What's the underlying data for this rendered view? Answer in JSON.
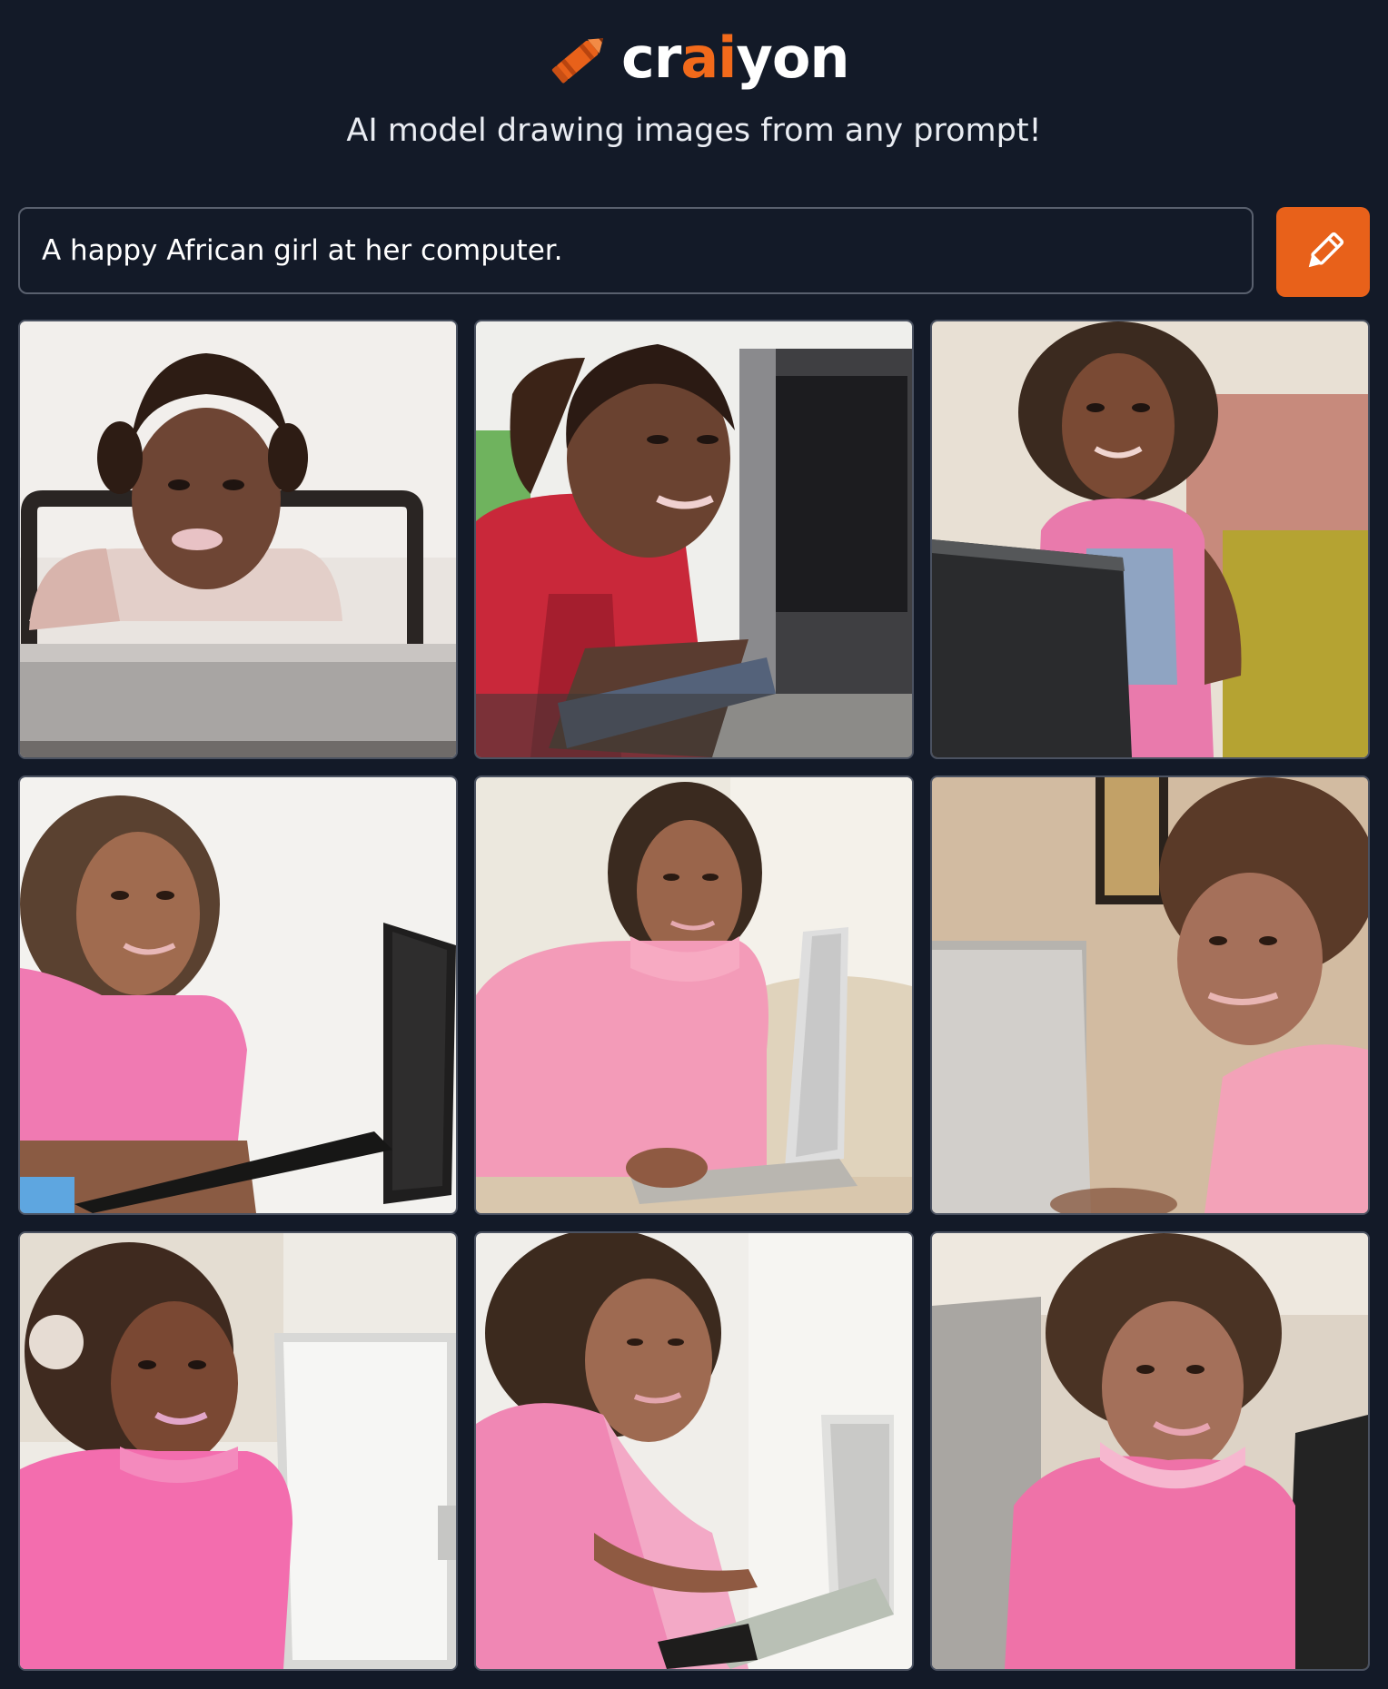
{
  "app": {
    "logo_prefix": "cr",
    "logo_ai": "ai",
    "logo_suffix": "yon",
    "tagline": "AI model drawing images from any prompt!",
    "accent_color": "#f26a1b",
    "background_color": "#131a28"
  },
  "prompt": {
    "value": "A happy African girl at her computer.",
    "button_icon": "pencil-icon"
  },
  "results": {
    "count": 9,
    "images": [
      {
        "id": "generated-image-1",
        "scene": "girl in white sweater behind laptop on chair"
      },
      {
        "id": "generated-image-2",
        "scene": "girl in red shirt at monitor and keyboard"
      },
      {
        "id": "generated-image-3",
        "scene": "girl in pink top and apron beside laptop on couch"
      },
      {
        "id": "generated-image-4",
        "scene": "girl in pink t-shirt at desk with keyboard"
      },
      {
        "id": "generated-image-5",
        "scene": "girl in pink sweater typing at computer"
      },
      {
        "id": "generated-image-6",
        "scene": "girl in pink shirt leaning beside monitor"
      },
      {
        "id": "generated-image-7",
        "scene": "girl in pink sweater smiling at monitor"
      },
      {
        "id": "generated-image-8",
        "scene": "girl in pink top typing on keyboard"
      },
      {
        "id": "generated-image-9",
        "scene": "girl in pink top smiling near dark monitor"
      }
    ]
  }
}
